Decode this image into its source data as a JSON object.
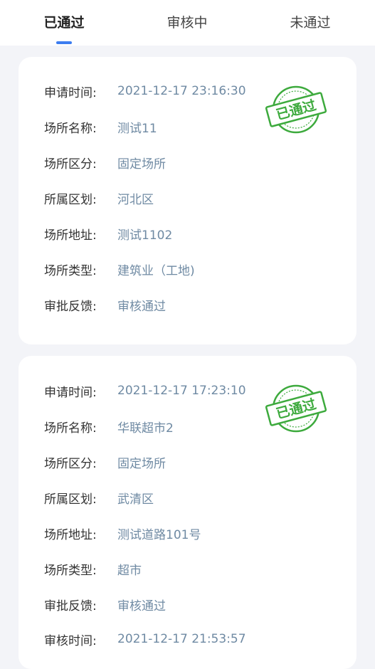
{
  "tabs": [
    {
      "label": "已通过"
    },
    {
      "label": "审核中"
    },
    {
      "label": "未通过"
    }
  ],
  "stamp_text": "已通过",
  "stamp_color": "#3daa3d",
  "accent_color": "#3c7df0",
  "cards": [
    {
      "rows": [
        {
          "label": "申请时间:",
          "value": "2021-12-17 23:16:30"
        },
        {
          "label": "场所名称:",
          "value": "测试11"
        },
        {
          "label": "场所区分:",
          "value": "固定场所"
        },
        {
          "label": "所属区划:",
          "value": "河北区"
        },
        {
          "label": "场所地址:",
          "value": "测试1102"
        },
        {
          "label": "场所类型:",
          "value": "建筑业（工地)"
        },
        {
          "label": "审批反馈:",
          "value": "审核通过"
        }
      ]
    },
    {
      "rows": [
        {
          "label": "申请时间:",
          "value": "2021-12-17 17:23:10"
        },
        {
          "label": "场所名称:",
          "value": "华联超市2"
        },
        {
          "label": "场所区分:",
          "value": "固定场所"
        },
        {
          "label": "所属区划:",
          "value": "武清区"
        },
        {
          "label": "场所地址:",
          "value": "测试道路101号"
        },
        {
          "label": "场所类型:",
          "value": "超市"
        },
        {
          "label": "审批反馈:",
          "value": "审核通过"
        },
        {
          "label": "审核时间:",
          "value": "2021-12-17 21:53:57"
        }
      ]
    }
  ]
}
